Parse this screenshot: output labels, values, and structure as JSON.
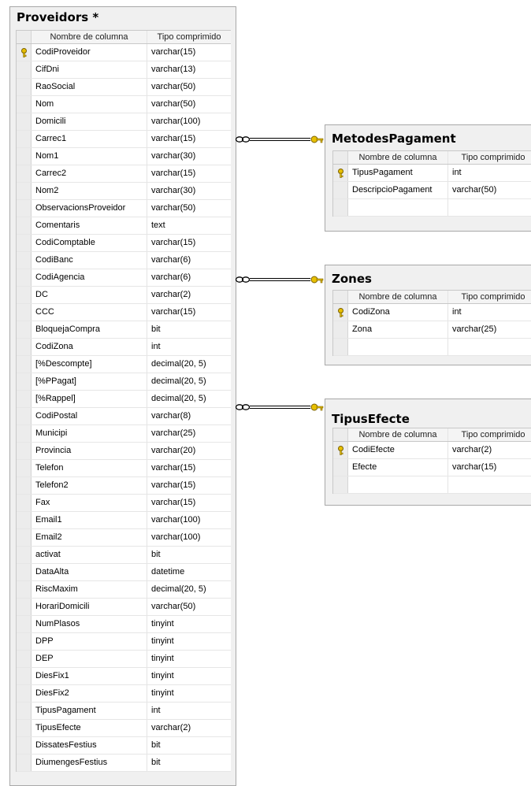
{
  "header_labels": {
    "column_name": "Nombre de columna",
    "type": "Tipo comprimido"
  },
  "tables": {
    "proveidors": {
      "title": "Proveidors *",
      "rows": [
        {
          "name": "CodiProveidor",
          "type": "varchar(15)",
          "key": true
        },
        {
          "name": "CifDni",
          "type": "varchar(13)"
        },
        {
          "name": "RaoSocial",
          "type": "varchar(50)"
        },
        {
          "name": "Nom",
          "type": "varchar(50)"
        },
        {
          "name": "Domicili",
          "type": "varchar(100)"
        },
        {
          "name": "Carrec1",
          "type": "varchar(15)"
        },
        {
          "name": "Nom1",
          "type": "varchar(30)"
        },
        {
          "name": "Carrec2",
          "type": "varchar(15)"
        },
        {
          "name": "Nom2",
          "type": "varchar(30)"
        },
        {
          "name": "ObservacionsProveidor",
          "type": "varchar(50)"
        },
        {
          "name": "Comentaris",
          "type": "text"
        },
        {
          "name": "CodiComptable",
          "type": "varchar(15)"
        },
        {
          "name": "CodiBanc",
          "type": "varchar(6)"
        },
        {
          "name": "CodiAgencia",
          "type": "varchar(6)"
        },
        {
          "name": "DC",
          "type": "varchar(2)"
        },
        {
          "name": "CCC",
          "type": "varchar(15)"
        },
        {
          "name": "BloquejaCompra",
          "type": "bit"
        },
        {
          "name": "CodiZona",
          "type": "int"
        },
        {
          "name": "[%Descompte]",
          "type": "decimal(20, 5)"
        },
        {
          "name": "[%PPagat]",
          "type": "decimal(20, 5)"
        },
        {
          "name": "[%Rappel]",
          "type": "decimal(20, 5)"
        },
        {
          "name": "CodiPostal",
          "type": "varchar(8)"
        },
        {
          "name": "Municipi",
          "type": "varchar(25)"
        },
        {
          "name": "Provincia",
          "type": "varchar(20)"
        },
        {
          "name": "Telefon",
          "type": "varchar(15)"
        },
        {
          "name": "Telefon2",
          "type": "varchar(15)"
        },
        {
          "name": "Fax",
          "type": "varchar(15)"
        },
        {
          "name": "Email1",
          "type": "varchar(100)"
        },
        {
          "name": "Email2",
          "type": "varchar(100)"
        },
        {
          "name": "activat",
          "type": "bit"
        },
        {
          "name": "DataAlta",
          "type": "datetime"
        },
        {
          "name": "RiscMaxim",
          "type": "decimal(20, 5)"
        },
        {
          "name": "HorariDomicili",
          "type": "varchar(50)"
        },
        {
          "name": "NumPlasos",
          "type": "tinyint"
        },
        {
          "name": "DPP",
          "type": "tinyint"
        },
        {
          "name": "DEP",
          "type": "tinyint"
        },
        {
          "name": "DiesFix1",
          "type": "tinyint"
        },
        {
          "name": "DiesFix2",
          "type": "tinyint"
        },
        {
          "name": "TipusPagament",
          "type": "int"
        },
        {
          "name": "TipusEfecte",
          "type": "varchar(2)"
        },
        {
          "name": "DissatesFestius",
          "type": "bit"
        },
        {
          "name": "DiumengesFestius",
          "type": "bit"
        }
      ]
    },
    "metodes": {
      "title": "MetodesPagament",
      "rows": [
        {
          "name": "TipusPagament",
          "type": "int",
          "key": true
        },
        {
          "name": "DescripcioPagament",
          "type": "varchar(50)"
        },
        {
          "name": "",
          "type": ""
        }
      ]
    },
    "zones": {
      "title": "Zones",
      "rows": [
        {
          "name": "CodiZona",
          "type": "int",
          "key": true
        },
        {
          "name": "Zona",
          "type": "varchar(25)"
        },
        {
          "name": "",
          "type": ""
        }
      ]
    },
    "tipus": {
      "title": "TipusEfecte",
      "rows": [
        {
          "name": "CodiEfecte",
          "type": "varchar(2)",
          "key": true
        },
        {
          "name": "Efecte",
          "type": "varchar(15)"
        },
        {
          "name": "",
          "type": ""
        }
      ]
    }
  },
  "relationships": [
    "metodes",
    "zones",
    "tipus"
  ],
  "colors": {
    "key_gold": "#e8c000",
    "key_outline": "#7a6000",
    "line": "#000000"
  }
}
